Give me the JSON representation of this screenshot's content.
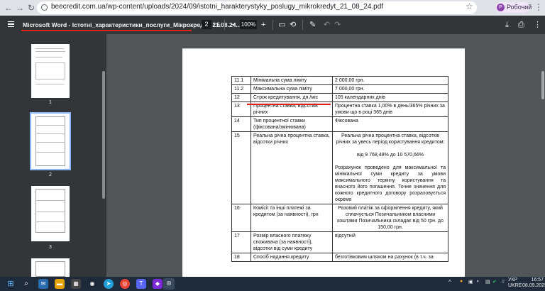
{
  "browser": {
    "url": "beecredit.com.ua/wp-content/uploads/2024/09/istotni_harakterystyky_poslugy_mikrokredyt_21_08_24.pdf",
    "profile_initial": "Р",
    "profile_name": "Робочий"
  },
  "pdf_toolbar": {
    "title": "Microsoft Word - Істотні_характеристики_послуги_Мікрокредит 21.08.24....",
    "current_page": "2",
    "page_separator": "/",
    "total_pages": "6",
    "zoom": "100%"
  },
  "thumbnails": [
    {
      "label": "1"
    },
    {
      "label": "2"
    },
    {
      "label": "3"
    }
  ],
  "table": {
    "rows": [
      {
        "num": "11.1",
        "param": "Мінімальна сума ліміту",
        "value": "2 000,00 грн."
      },
      {
        "num": "11.2",
        "param": "Максимальна сума ліміту",
        "value": "7 000,00 грн."
      },
      {
        "num": "12",
        "param": "Строк кредитування, дн./міс",
        "value": "105 календарних днів"
      },
      {
        "num": "13",
        "param": "Процентна ставка, відсотків річних",
        "value": "Процентна ставка 1,00% в день/365% річних за умови що в році 365 днів"
      },
      {
        "num": "14",
        "param": "Тип процентної ставки (фіксована/змінювана)",
        "value": "Фіксована"
      },
      {
        "num": "15",
        "param": "Реальна річна процентна ставка, відсотки річних",
        "value_p1": "Реальна річна процентна ставка, відсоткiв річних за увесь період користування кредитом:",
        "value_p2": "від 9 768,48% до 10 570,66%",
        "value_p3": "Розрахунок проведено для максимальної та мінімальної суми кредиту за умови максимального терміну користування та вчасного його погашення. Точне значення для кожного кредитного договору розраховується окремо"
      },
      {
        "num": "16",
        "param": "Комісії та інші платежі за кредитом (за наявності), грн",
        "value": "Разовий платіж за оформлення кредиту, який сплачується Позичальником власними коштами Позичальника складає від 50 грн. до 150,00 грн."
      },
      {
        "num": "17",
        "param": "Розмір власного платежу споживача (за наявності), відсотки від суми кредиту",
        "value": "відсутній"
      },
      {
        "num": "18",
        "param": "Спосіб надання кредиту",
        "value": "безготівковим шляхом на рахунок (в т.ч. за"
      }
    ]
  },
  "taskbar": {
    "lang_top": "УКР",
    "lang_bottom": "UKRE",
    "time": "16:57",
    "date": "08.09.2025"
  },
  "colors": {
    "annotation_red": "#e0201b",
    "toolbar_bg": "#323639",
    "viewer_bg": "#525659"
  }
}
